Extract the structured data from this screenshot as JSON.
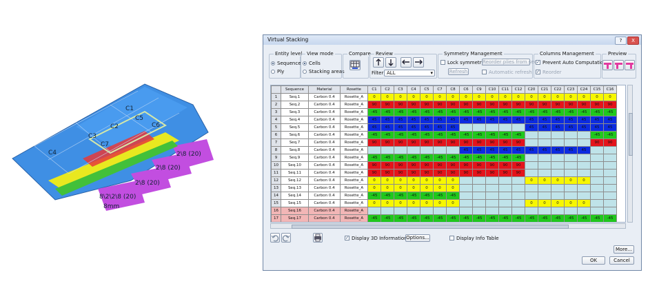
{
  "model": {
    "labels": [
      "C1",
      "C5",
      "C3",
      "C7",
      "C4",
      "C2",
      "C6",
      "2\\8 (20)",
      "2\\8 (20)",
      "2\\8 (20)",
      "8\\2\\2\\8 (20)",
      "8mm"
    ]
  },
  "dialog": {
    "title": "Virtual Stacking",
    "help_label": "?",
    "close_label": "X",
    "entity_level": {
      "label": "Entity level",
      "options": [
        "Sequence",
        "Ply"
      ]
    },
    "view_mode": {
      "label": "View mode",
      "options": [
        "Cells",
        "Stacking areas"
      ]
    },
    "compare": {
      "label": "Compare"
    },
    "review": {
      "label": "Review",
      "filter_label": "Filter:",
      "filter_value": "ALL"
    },
    "symmetry": {
      "label": "Symmetry Management",
      "lock": "Lock symmetry",
      "reorder_btn": "Reorder plies from seq",
      "refresh_btn": "Refresh",
      "auto_refresh": "Automatic refresh"
    },
    "columns": {
      "label": "Columns Management",
      "prevent": "Prevent Auto Computation",
      "reorder": "Reorder"
    },
    "preview": {
      "label": "Preview"
    },
    "table": {
      "headers": [
        "Sequence",
        "Material",
        "Rosette"
      ],
      "cell_headers": [
        "C1",
        "C2",
        "C3",
        "C4",
        "C5",
        "C7",
        "C8",
        "C6",
        "C9",
        "C10",
        "C11",
        "C12",
        "C20",
        "C21",
        "C22",
        "C23",
        "C24",
        "C15",
        "C16"
      ],
      "rows": [
        {
          "n": "1",
          "seq": "Seq.1",
          "mat": "Carbon 0.4",
          "ros": "Rosette_A",
          "fill": "0",
          "val": "0"
        },
        {
          "n": "2",
          "seq": "Seq.2",
          "mat": "Carbon 0.4",
          "ros": "Rosette_A",
          "fill": "90",
          "val": "90"
        },
        {
          "n": "3",
          "seq": "Seq.3",
          "mat": "Carbon 0.4",
          "ros": "Rosette_A",
          "fill": "m45",
          "val": "-45"
        },
        {
          "n": "4",
          "seq": "Seq.4",
          "mat": "Carbon 0.4",
          "ros": "Rosette_A",
          "fill": "45",
          "val": "45"
        },
        {
          "n": "5",
          "seq": "Seq.5",
          "mat": "Carbon 0.4",
          "ros": "Rosette_A",
          "fill": "45",
          "val": "45",
          "empty": [
            7,
            8,
            9,
            10,
            11
          ]
        },
        {
          "n": "6",
          "seq": "Seq.6",
          "mat": "Carbon 0.4",
          "ros": "Rosette_A",
          "fill": "m45",
          "val": "-45",
          "empty": [
            12,
            13,
            14,
            15,
            16
          ]
        },
        {
          "n": "7",
          "seq": "Seq.7",
          "mat": "Carbon 0.4",
          "ros": "Rosette_A",
          "fill": "90",
          "val": "90",
          "empty": [
            12,
            13,
            14,
            15,
            16
          ]
        },
        {
          "n": "8",
          "seq": "Seq.8",
          "mat": "Carbon 0.4",
          "ros": "Rosette_A",
          "fill": "45",
          "val": "45",
          "empty": [
            0,
            1,
            2,
            3,
            4,
            5,
            6,
            17,
            18
          ]
        },
        {
          "n": "9",
          "seq": "Seq.9",
          "mat": "Carbon 0.4",
          "ros": "Rosette_A",
          "fill": "m45",
          "val": "-45",
          "empty": [
            12,
            13,
            14,
            15,
            16,
            17,
            18
          ]
        },
        {
          "n": "10",
          "seq": "Seq.10",
          "mat": "Carbon 0.4",
          "ros": "Rosette_A",
          "fill": "90",
          "val": "90",
          "empty": [
            12,
            13,
            14,
            15,
            16,
            17,
            18
          ]
        },
        {
          "n": "11",
          "seq": "Seq.11",
          "mat": "Carbon 0.4",
          "ros": "Rosette_A",
          "fill": "90",
          "val": "90",
          "empty": [
            12,
            13,
            14,
            15,
            16,
            17,
            18
          ]
        },
        {
          "n": "12",
          "seq": "Seq.12",
          "mat": "Carbon 0.4",
          "ros": "Rosette_A",
          "fill": "0",
          "val": "0",
          "empty": [
            7,
            8,
            9,
            10,
            11,
            17,
            18
          ]
        },
        {
          "n": "13",
          "seq": "Seq.13",
          "mat": "Carbon 0.4",
          "ros": "Rosette_A",
          "fill": "0",
          "val": "0",
          "empty": [
            7,
            8,
            9,
            10,
            11,
            12,
            13,
            14,
            15,
            16,
            17,
            18
          ]
        },
        {
          "n": "14",
          "seq": "Seq.14",
          "mat": "Carbon 0.4",
          "ros": "Rosette_A",
          "fill": "m45",
          "val": "-45",
          "empty": [
            7,
            8,
            9,
            10,
            11,
            12,
            13,
            14,
            15,
            16,
            17,
            18
          ]
        },
        {
          "n": "15",
          "seq": "Seq.15",
          "mat": "Carbon 0.4",
          "ros": "Rosette_A",
          "fill": "0",
          "val": "0",
          "empty": [
            7,
            8,
            9,
            10,
            11,
            17,
            18
          ]
        },
        {
          "n": "16",
          "seq": "Seq.16",
          "mat": "Carbon 0.4",
          "ros": "Rosette_A",
          "fill": "0",
          "val": "0",
          "sel": true,
          "empty": [
            0,
            1,
            2,
            3,
            4,
            5,
            6,
            7,
            8,
            9,
            10,
            11,
            12,
            13,
            14,
            15,
            16,
            17,
            18
          ]
        },
        {
          "n": "17",
          "seq": "Seq.17",
          "mat": "Carbon 0.4",
          "ros": "Rosette_A",
          "fill": "m45",
          "val": "-45",
          "sel": true
        },
        {
          "n": "18",
          "seq": "Seq.18",
          "mat": "Carbon 0.4",
          "ros": "Rosette_A",
          "fill": "45",
          "val": "45",
          "empty": [
            7,
            8,
            9,
            10,
            11,
            12,
            13,
            14,
            15,
            16,
            17,
            18
          ]
        }
      ]
    },
    "bottom": {
      "display_3d": "Display 3D Information",
      "options_btn": "Options...",
      "display_info": "Display Info Table",
      "more_btn": "More...",
      "ok_btn": "OK",
      "cancel_btn": "Cancel"
    },
    "colors": {
      "0": "#f7f700",
      "90": "#e4141b",
      "45": "#0c2be0",
      "m45": "#20c81c",
      "empty": "#bfe3e9"
    }
  }
}
